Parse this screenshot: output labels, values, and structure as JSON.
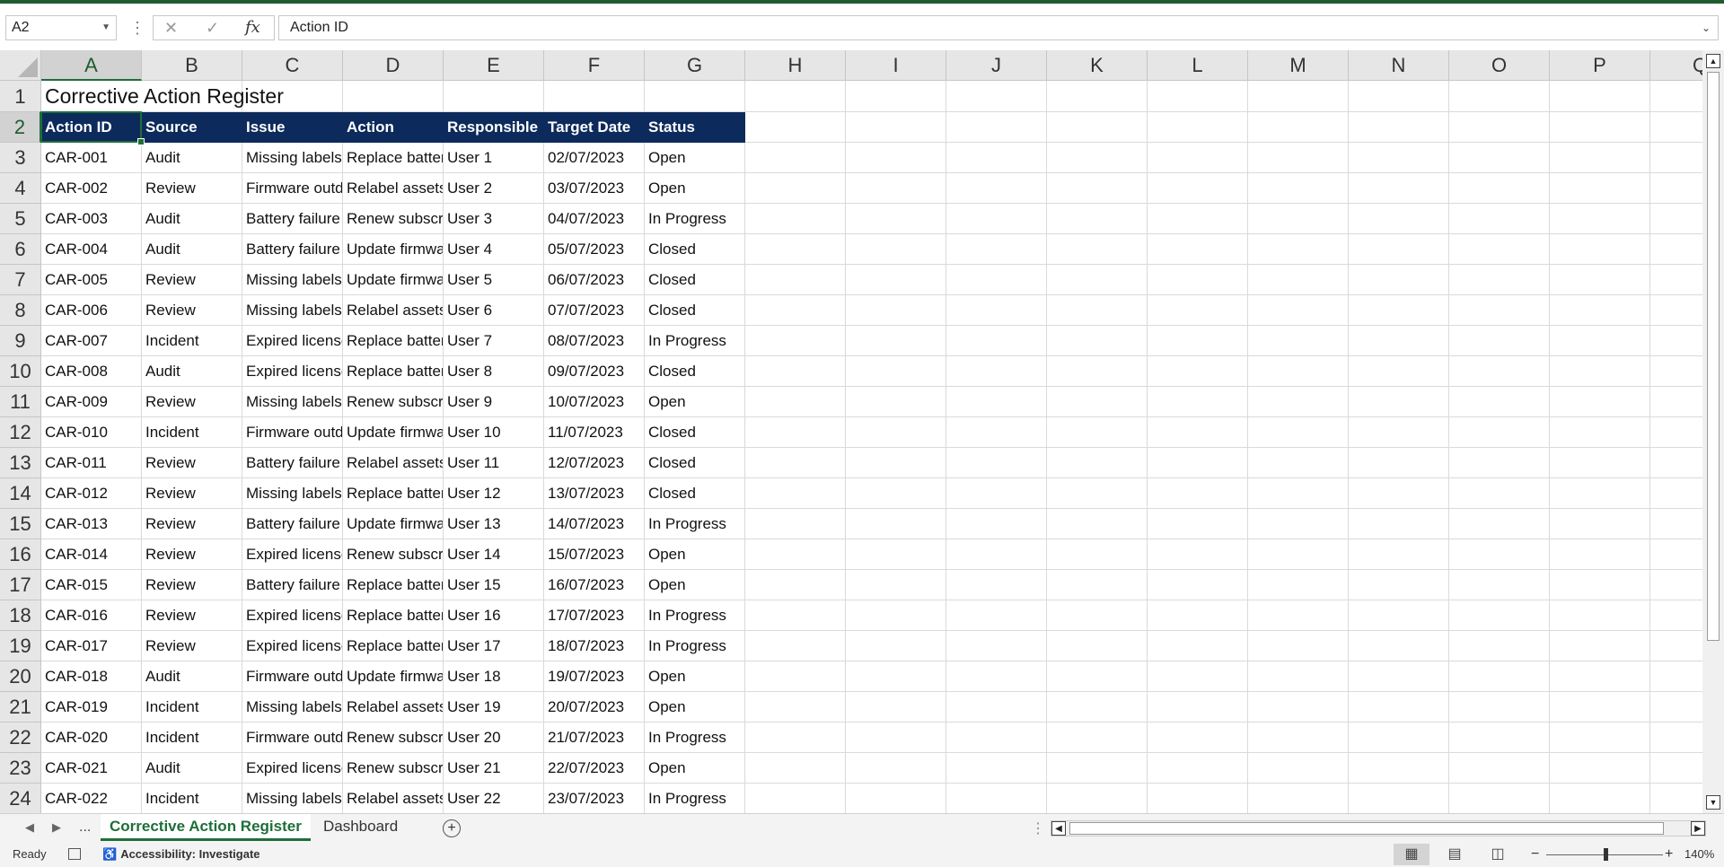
{
  "formula_bar": {
    "name_box": "A2",
    "cancel_glyph": "✕",
    "enter_glyph": "✓",
    "fx_label": "fx",
    "content": "Action ID"
  },
  "columns": [
    "A",
    "B",
    "C",
    "D",
    "E",
    "F",
    "G",
    "H",
    "I",
    "J",
    "K",
    "L",
    "M",
    "N",
    "O",
    "P",
    "Q"
  ],
  "title": "Corrective Action Register",
  "table": {
    "headers": [
      "Action ID",
      "Source",
      "Issue",
      "Action",
      "Responsible",
      "Target Date",
      "Status"
    ],
    "rows": [
      [
        "CAR-001",
        "Audit",
        "Missing labels",
        "Replace batteries",
        "User 1",
        "02/07/2023",
        "Open"
      ],
      [
        "CAR-002",
        "Review",
        "Firmware outdated",
        "Relabel assets",
        "User 2",
        "03/07/2023",
        "Open"
      ],
      [
        "CAR-003",
        "Audit",
        "Battery failure",
        "Renew subscription",
        "User 3",
        "04/07/2023",
        "In Progress"
      ],
      [
        "CAR-004",
        "Audit",
        "Battery failure",
        "Update firmware",
        "User 4",
        "05/07/2023",
        "Closed"
      ],
      [
        "CAR-005",
        "Review",
        "Missing labels",
        "Update firmware",
        "User 5",
        "06/07/2023",
        "Closed"
      ],
      [
        "CAR-006",
        "Review",
        "Missing labels",
        "Relabel assets",
        "User 6",
        "07/07/2023",
        "Closed"
      ],
      [
        "CAR-007",
        "Incident",
        "Expired license",
        "Replace batteries",
        "User 7",
        "08/07/2023",
        "In Progress"
      ],
      [
        "CAR-008",
        "Audit",
        "Expired license",
        "Replace batteries",
        "User 8",
        "09/07/2023",
        "Closed"
      ],
      [
        "CAR-009",
        "Review",
        "Missing labels",
        "Renew subscription",
        "User 9",
        "10/07/2023",
        "Open"
      ],
      [
        "CAR-010",
        "Incident",
        "Firmware outdated",
        "Update firmware",
        "User 10",
        "11/07/2023",
        "Closed"
      ],
      [
        "CAR-011",
        "Review",
        "Battery failure",
        "Relabel assets",
        "User 11",
        "12/07/2023",
        "Closed"
      ],
      [
        "CAR-012",
        "Review",
        "Missing labels",
        "Replace batteries",
        "User 12",
        "13/07/2023",
        "Closed"
      ],
      [
        "CAR-013",
        "Review",
        "Battery failure",
        "Update firmware",
        "User 13",
        "14/07/2023",
        "In Progress"
      ],
      [
        "CAR-014",
        "Review",
        "Expired license",
        "Renew subscription",
        "User 14",
        "15/07/2023",
        "Open"
      ],
      [
        "CAR-015",
        "Review",
        "Battery failure",
        "Replace batteries",
        "User 15",
        "16/07/2023",
        "Open"
      ],
      [
        "CAR-016",
        "Review",
        "Expired license",
        "Replace batteries",
        "User 16",
        "17/07/2023",
        "In Progress"
      ],
      [
        "CAR-017",
        "Review",
        "Expired license",
        "Replace batteries",
        "User 17",
        "18/07/2023",
        "In Progress"
      ],
      [
        "CAR-018",
        "Audit",
        "Firmware outdated",
        "Update firmware",
        "User 18",
        "19/07/2023",
        "Open"
      ],
      [
        "CAR-019",
        "Incident",
        "Missing labels",
        "Relabel assets",
        "User 19",
        "20/07/2023",
        "Open"
      ],
      [
        "CAR-020",
        "Incident",
        "Firmware outdated",
        "Renew subscription",
        "User 20",
        "21/07/2023",
        "In Progress"
      ],
      [
        "CAR-021",
        "Audit",
        "Expired license",
        "Renew subscription",
        "User 21",
        "22/07/2023",
        "Open"
      ],
      [
        "CAR-022",
        "Incident",
        "Missing labels",
        "Relabel assets",
        "User 22",
        "23/07/2023",
        "In Progress"
      ]
    ]
  },
  "colors": {
    "header_fill": "#0d2a5c",
    "accent": "#1e6e3a"
  },
  "sheets": {
    "nav_prev": "◀",
    "nav_next": "▶",
    "nav_more": "...",
    "tabs": [
      "Corrective Action Register",
      "Dashboard"
    ],
    "active": "Corrective Action Register",
    "add_glyph": "+"
  },
  "status_bar": {
    "ready": "Ready",
    "accessibility": "Accessibility: Investigate",
    "zoom": "140%",
    "zoom_minus": "−",
    "zoom_plus": "+"
  }
}
